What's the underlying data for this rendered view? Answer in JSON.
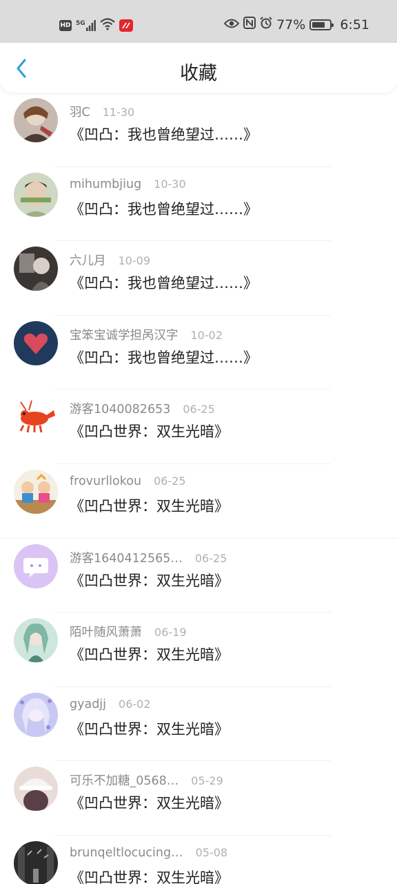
{
  "status_bar": {
    "hd_label": "HD",
    "network_label": "5G",
    "battery_percent": "77%",
    "battery_level": 0.77,
    "time": "6:51",
    "icons": [
      "hd-icon",
      "signal-icon",
      "wifi-icon",
      "app-notification-icon",
      "eye-icon",
      "nfc-icon",
      "alarm-icon",
      "battery-icon"
    ]
  },
  "header": {
    "title": "收藏",
    "back_icon": "chevron-left-icon"
  },
  "colors": {
    "accent": "#2a9fd8",
    "status_bar_bg": "#dcdcdc",
    "username": "#8a8a8a",
    "date": "#b0b0b0"
  },
  "items": [
    {
      "username": "羽C",
      "date": "11-30",
      "work": "《凹凸：我也曾绝望过……》"
    },
    {
      "username": "mihumbjiug",
      "date": "10-30",
      "work": "《凹凸：我也曾绝望过……》"
    },
    {
      "username": "六儿月",
      "date": "10-09",
      "work": "《凹凸：我也曾绝望过……》"
    },
    {
      "username": "宝笨宝诚学担呙汉字",
      "date": "10-02",
      "work": "《凹凸：我也曾绝望过……》"
    },
    {
      "username": "游客1040082653",
      "date": "06-25",
      "work": "《凹凸世界：双生光暗》"
    },
    {
      "username": "frovurllokou",
      "date": "06-25",
      "work": "《凹凸世界：双生光暗》"
    },
    {
      "username": "游客1640412565…",
      "date": "06-25",
      "work": "《凹凸世界：双生光暗》"
    },
    {
      "username": "陌叶随风萧萧",
      "date": "06-19",
      "work": "《凹凸世界：双生光暗》"
    },
    {
      "username": "gyadjj",
      "date": "06-02",
      "work": "《凹凸世界：双生光暗》"
    },
    {
      "username": "可乐不加糖_0568…",
      "date": "05-29",
      "work": "《凹凸世界：双生光暗》"
    },
    {
      "username": "brunqeltlocucing…",
      "date": "05-08",
      "work": "《凹凸世界：双生光暗》"
    }
  ]
}
